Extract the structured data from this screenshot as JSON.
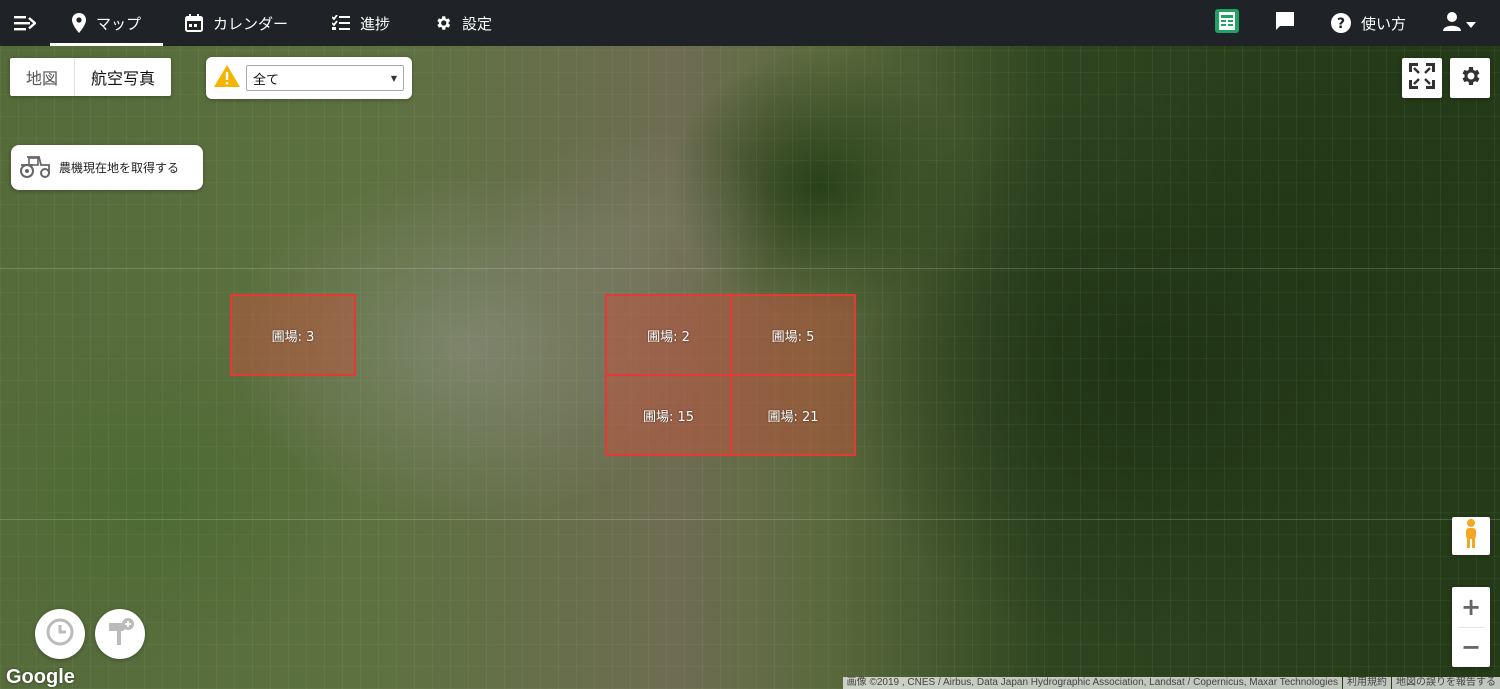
{
  "nav": {
    "items": [
      {
        "label": "マップ",
        "icon": "map-pin-icon",
        "active": true
      },
      {
        "label": "カレンダー",
        "icon": "calendar-icon",
        "active": false
      },
      {
        "label": "進捗",
        "icon": "checklist-icon",
        "active": false
      },
      {
        "label": "設定",
        "icon": "gear-icon",
        "active": false
      }
    ],
    "help_label": "使い方"
  },
  "map_type": {
    "map": "地図",
    "satellite": "航空写真",
    "selected": "航空写真"
  },
  "filter": {
    "value": "全て",
    "icon": "warning-icon",
    "icon_color": "#f4b400"
  },
  "tractor_button": {
    "label": "農機現在地を取得する"
  },
  "fields": [
    {
      "label": "圃場: 3"
    },
    {
      "label": "圃場: 2"
    },
    {
      "label": "圃場: 5"
    },
    {
      "label": "圃場: 15"
    },
    {
      "label": "圃場: 21"
    }
  ],
  "field_color": "#e53935",
  "zoom": {
    "in": "+",
    "out": "−"
  },
  "google_logo": "Google",
  "attribution": {
    "imagery": "画像 ©2019 , CNES / Airbus, Data Japan Hydrographic Association, Landsat / Copernicus, Maxar Technologies",
    "terms": "利用規約",
    "report": "地図の誤りを報告する"
  }
}
